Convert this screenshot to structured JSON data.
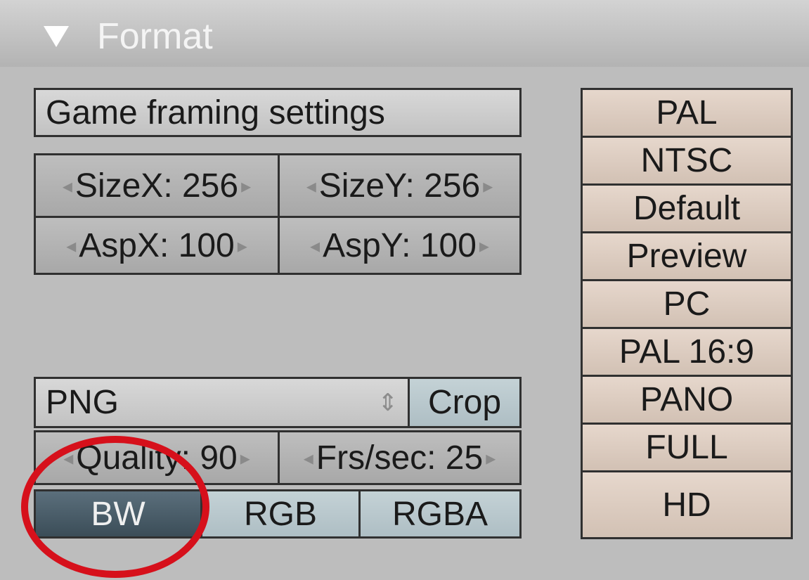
{
  "panel": {
    "title": "Format"
  },
  "game_framing": {
    "label": "Game framing settings"
  },
  "size": {
    "x_label": "SizeX: 256",
    "y_label": "SizeY: 256"
  },
  "aspect": {
    "x_label": "AspX: 100",
    "y_label": "AspY: 100"
  },
  "output": {
    "format": "PNG",
    "crop_label": "Crop",
    "quality_label": "Quality: 90",
    "fps_label": "Frs/sec: 25"
  },
  "color_mode": {
    "options": [
      "BW",
      "RGB",
      "RGBA"
    ],
    "selected": "BW"
  },
  "presets": [
    "PAL",
    "NTSC",
    "Default",
    "Preview",
    "PC",
    "PAL 16:9",
    "PANO",
    "FULL",
    "HD"
  ]
}
